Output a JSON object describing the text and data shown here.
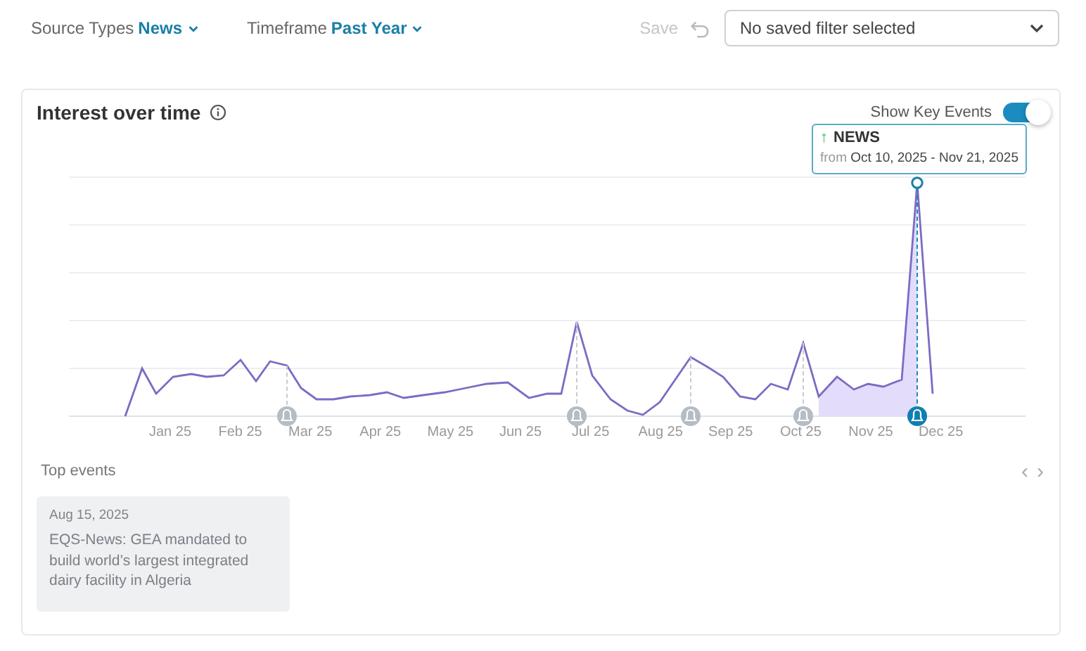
{
  "filters": [
    {
      "label": "Source Types",
      "value": "News"
    },
    {
      "label": "Timeframe",
      "value": "Past Year"
    }
  ],
  "save": {
    "label": "Save",
    "disabled": true
  },
  "saved_filter": {
    "placeholder": "No saved filter selected"
  },
  "card": {
    "title": "Interest over time",
    "toggle": {
      "label": "Show Key Events",
      "on": true
    },
    "tooltip": {
      "icon": "↑",
      "title": "NEWS",
      "prefix": "from",
      "range": "Oct 10, 2025 - Nov 21, 2025"
    },
    "x_labels": [
      "Jan 25",
      "Feb 25",
      "Mar 25",
      "Apr 25",
      "May 25",
      "Jun 25",
      "Jul 25",
      "Aug 25",
      "Sep 25",
      "Oct 25",
      "Nov 25",
      "Dec 25"
    ],
    "event_markers": [
      {
        "selected": false
      },
      {
        "selected": false
      },
      {
        "selected": false
      },
      {
        "selected": false
      },
      {
        "selected": true
      }
    ]
  },
  "top_events": {
    "title": "Top events",
    "prev": "‹",
    "next": "›",
    "items": [
      {
        "date": "Aug 15, 2025",
        "headline": "EQS-News: GEA mandated to build world’s largest integrated dairy facility in Algeria",
        "disabled": true
      }
    ]
  }
}
